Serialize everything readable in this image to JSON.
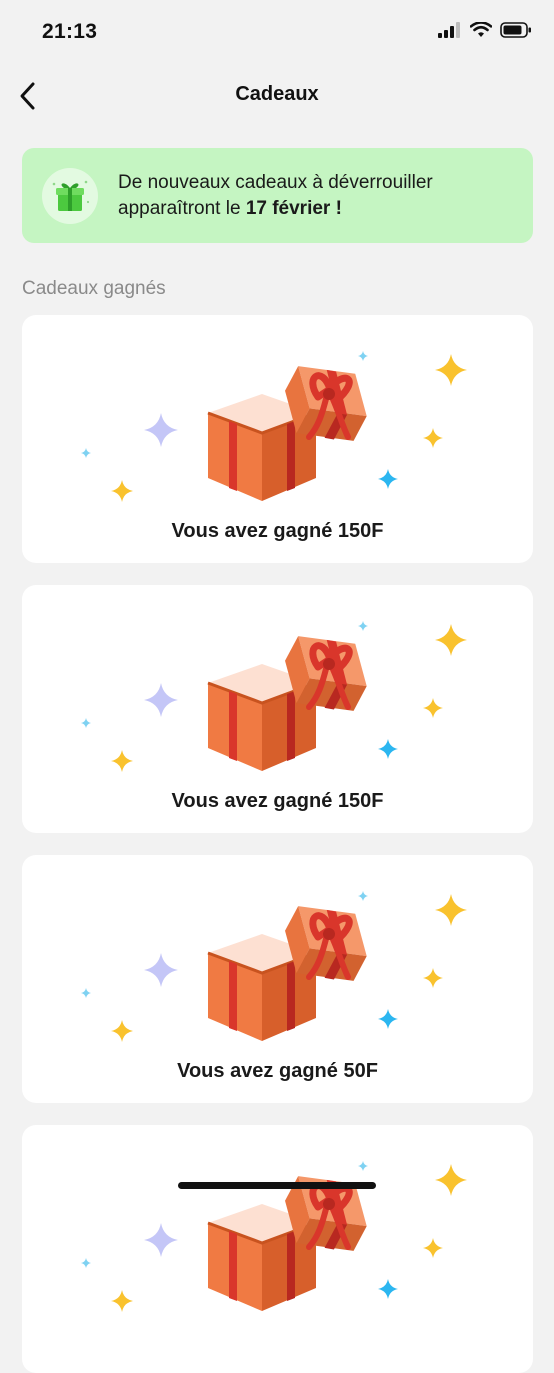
{
  "status_bar": {
    "time": "21:13"
  },
  "nav": {
    "title": "Cadeaux"
  },
  "banner": {
    "line1": "De nouveaux cadeaux à déverrouiller",
    "line2_prefix": "apparaîtront le ",
    "line2_date": "17 février",
    "line2_suffix": " !",
    "icon": "gift-icon"
  },
  "section": {
    "title": "Cadeaux gagnés"
  },
  "gifts": [
    {
      "label": "Vous avez gagné 150F"
    },
    {
      "label": "Vous avez gagné 150F"
    },
    {
      "label": "Vous avez gagné 50F"
    },
    {
      "label": ""
    }
  ],
  "colors": {
    "banner_bg": "#c5f5c2",
    "box_orange": "#f07a43",
    "ribbon_red": "#d9362b",
    "sparkle_gold": "#f9c22e",
    "sparkle_blue": "#2bb6f0",
    "sparkle_lavender": "#c4c6f7"
  }
}
